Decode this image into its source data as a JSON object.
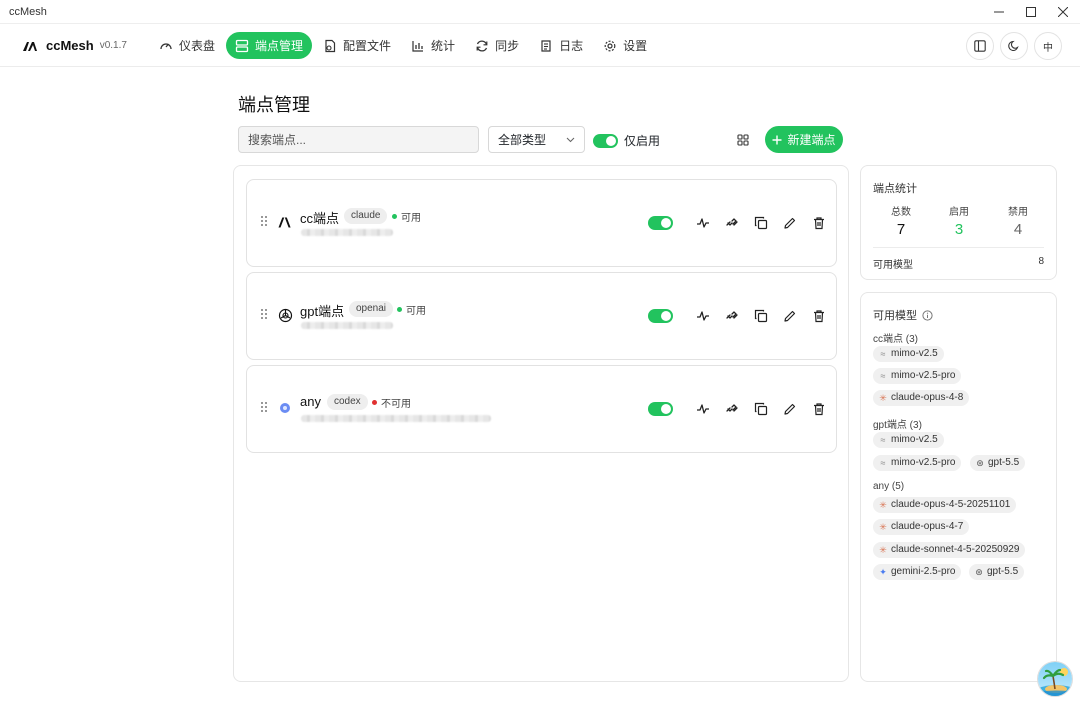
{
  "window": {
    "title": "ccMesh"
  },
  "brand": {
    "name": "ccMesh",
    "version": "v0.1.7"
  },
  "nav": [
    {
      "label": "仪表盘",
      "icon": "gauge-icon"
    },
    {
      "label": "端点管理",
      "icon": "server-icon",
      "active": true
    },
    {
      "label": "配置文件",
      "icon": "file-config-icon"
    },
    {
      "label": "统计",
      "icon": "bar-chart-icon"
    },
    {
      "label": "同步",
      "icon": "sync-icon"
    },
    {
      "label": "日志",
      "icon": "log-icon"
    },
    {
      "label": "设置",
      "icon": "gear-icon"
    }
  ],
  "nav_right": {
    "lang": "中"
  },
  "page": {
    "title": "端点管理",
    "search_placeholder": "搜索端点...",
    "type_filter": "全部类型",
    "only_enabled": "仅启用",
    "new_button": "新建端点"
  },
  "endpoints": [
    {
      "name": "cc端点",
      "tag": "claude",
      "status": "可用",
      "status_color": "#22c35e",
      "enabled": true
    },
    {
      "name": "gpt端点",
      "tag": "openai",
      "status": "可用",
      "status_color": "#22c35e",
      "enabled": true
    },
    {
      "name": "any",
      "tag": "codex",
      "status": "不可用",
      "status_color": "#e03131",
      "enabled": true
    }
  ],
  "stats": {
    "title": "端点统计",
    "total_label": "总数",
    "total": "7",
    "enabled_label": "启用",
    "enabled": "3",
    "disabled_label": "禁用",
    "disabled": "4",
    "models_label": "可用模型",
    "models_count": "8"
  },
  "models": {
    "title": "可用模型",
    "groups": [
      {
        "label": "cc端点 (3)",
        "items": [
          {
            "name": "mimo-v2.5",
            "icon": "wave-icon"
          },
          {
            "name": "mimo-v2.5-pro",
            "icon": "wave-icon"
          },
          {
            "name": "claude-opus-4-8",
            "icon": "claude-burst-icon"
          }
        ]
      },
      {
        "label": "gpt端点 (3)",
        "items": [
          {
            "name": "mimo-v2.5",
            "icon": "wave-icon"
          },
          {
            "name": "mimo-v2.5-pro",
            "icon": "wave-icon"
          },
          {
            "name": "gpt-5.5",
            "icon": "openai-icon"
          }
        ]
      },
      {
        "label": "any (5)",
        "items": [
          {
            "name": "claude-opus-4-5-20251101",
            "icon": "claude-burst-icon"
          },
          {
            "name": "claude-opus-4-7",
            "icon": "claude-burst-icon"
          },
          {
            "name": "claude-sonnet-4-5-20250929",
            "icon": "claude-burst-icon"
          },
          {
            "name": "gemini-2.5-pro",
            "icon": "gemini-star-icon"
          },
          {
            "name": "gpt-5.5",
            "icon": "openai-icon"
          }
        ]
      }
    ]
  },
  "colors": {
    "accent": "#22c35e",
    "error": "#e03131",
    "claude": "#d97757",
    "gemini": "#4a7cf0"
  }
}
